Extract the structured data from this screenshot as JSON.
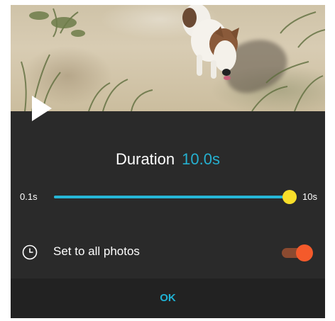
{
  "dialog": {
    "duration_label": "Duration",
    "duration_value": "10.0s",
    "slider": {
      "min_label": "0.1s",
      "max_label": "10s",
      "min": 0.1,
      "max": 10,
      "value": 10.0
    },
    "set_all_label": "Set to all photos",
    "set_all_enabled": true,
    "ok_label": "OK"
  },
  "colors": {
    "accent": "#25b0d0",
    "thumb": "#f8de2a",
    "toggle_on": "#f45a2b",
    "background": "#2a2a2a"
  },
  "icons": {
    "play": "play-icon",
    "clock": "clock-icon"
  }
}
